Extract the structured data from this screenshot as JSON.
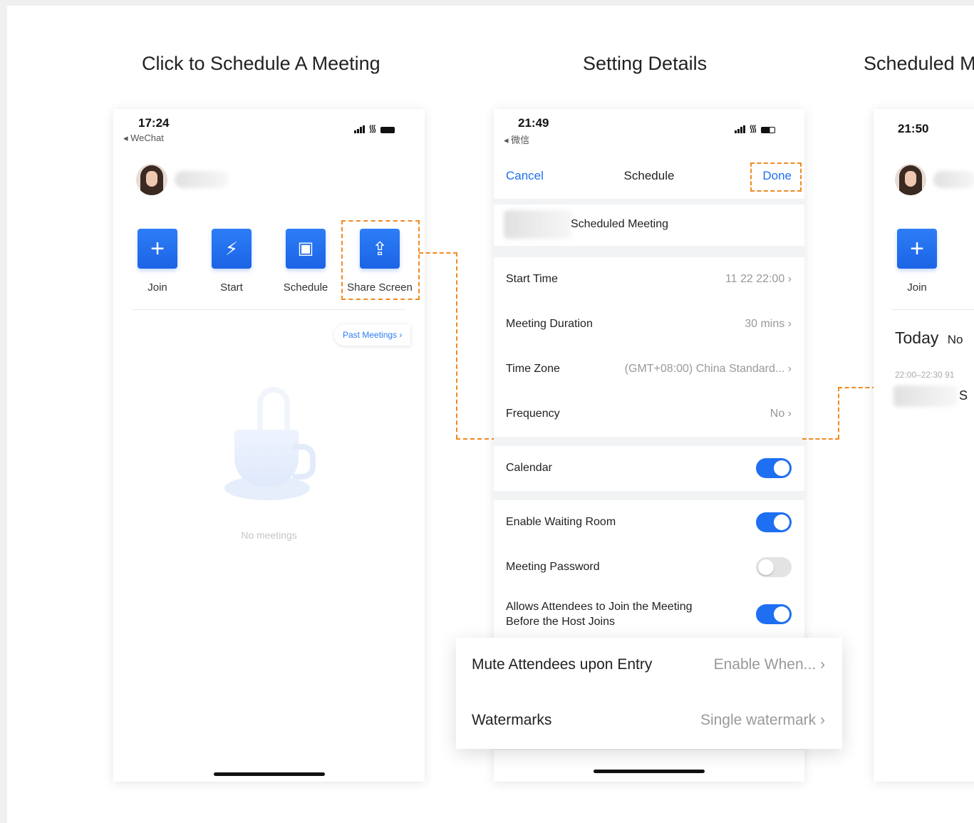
{
  "step_titles": [
    "Click to Schedule A Meeting",
    "Setting Details",
    "Scheduled M"
  ],
  "phone1": {
    "time": "17:24",
    "back_app": "◂ WeChat",
    "actions": [
      {
        "label": "Join",
        "icon": "plus-icon",
        "glyph": "+"
      },
      {
        "label": "Start",
        "icon": "lightning-icon",
        "glyph": "⚡"
      },
      {
        "label": "Schedule",
        "icon": "calendar-check-icon",
        "glyph": "▣"
      },
      {
        "label": "Share Screen",
        "icon": "share-screen-icon",
        "glyph": "⇪"
      }
    ],
    "past_meetings": "Past Meetings ›",
    "empty_text": "No meetings"
  },
  "phone2": {
    "time": "21:49",
    "back_app": "◂ 微信",
    "nav": {
      "cancel": "Cancel",
      "title": "Schedule",
      "done": "Done"
    },
    "meeting_name_suffix": "Scheduled Meeting",
    "rows": [
      {
        "label": "Start Time",
        "value": "11 22  22:00 ›"
      },
      {
        "label": "Meeting Duration",
        "value": "30 mins ›"
      },
      {
        "label": "Time Zone",
        "value": "(GMT+08:00) China Standard... ›"
      },
      {
        "label": "Frequency",
        "value": "No ›"
      }
    ],
    "calendar": {
      "label": "Calendar",
      "on": true
    },
    "options": [
      {
        "label": "Enable Waiting Room",
        "on": true
      },
      {
        "label": "Meeting Password",
        "on": false
      },
      {
        "label": "Allows Attendees to Join the Meeting",
        "label2": "Before the Host Joins",
        "on": true
      }
    ],
    "popup": [
      {
        "label": "Mute Attendees upon Entry",
        "value": "Enable When... ›"
      },
      {
        "label": "Watermarks",
        "value": "Single watermark ›"
      }
    ]
  },
  "phone3": {
    "time": "21:50",
    "join_label": "Join",
    "today": "Today",
    "today_suffix": "No",
    "meeting_time": "22:00–22:30  91",
    "meeting_title_initial": "S"
  },
  "colors": {
    "accent": "#1e6ff1",
    "highlight": "#f08a24"
  }
}
